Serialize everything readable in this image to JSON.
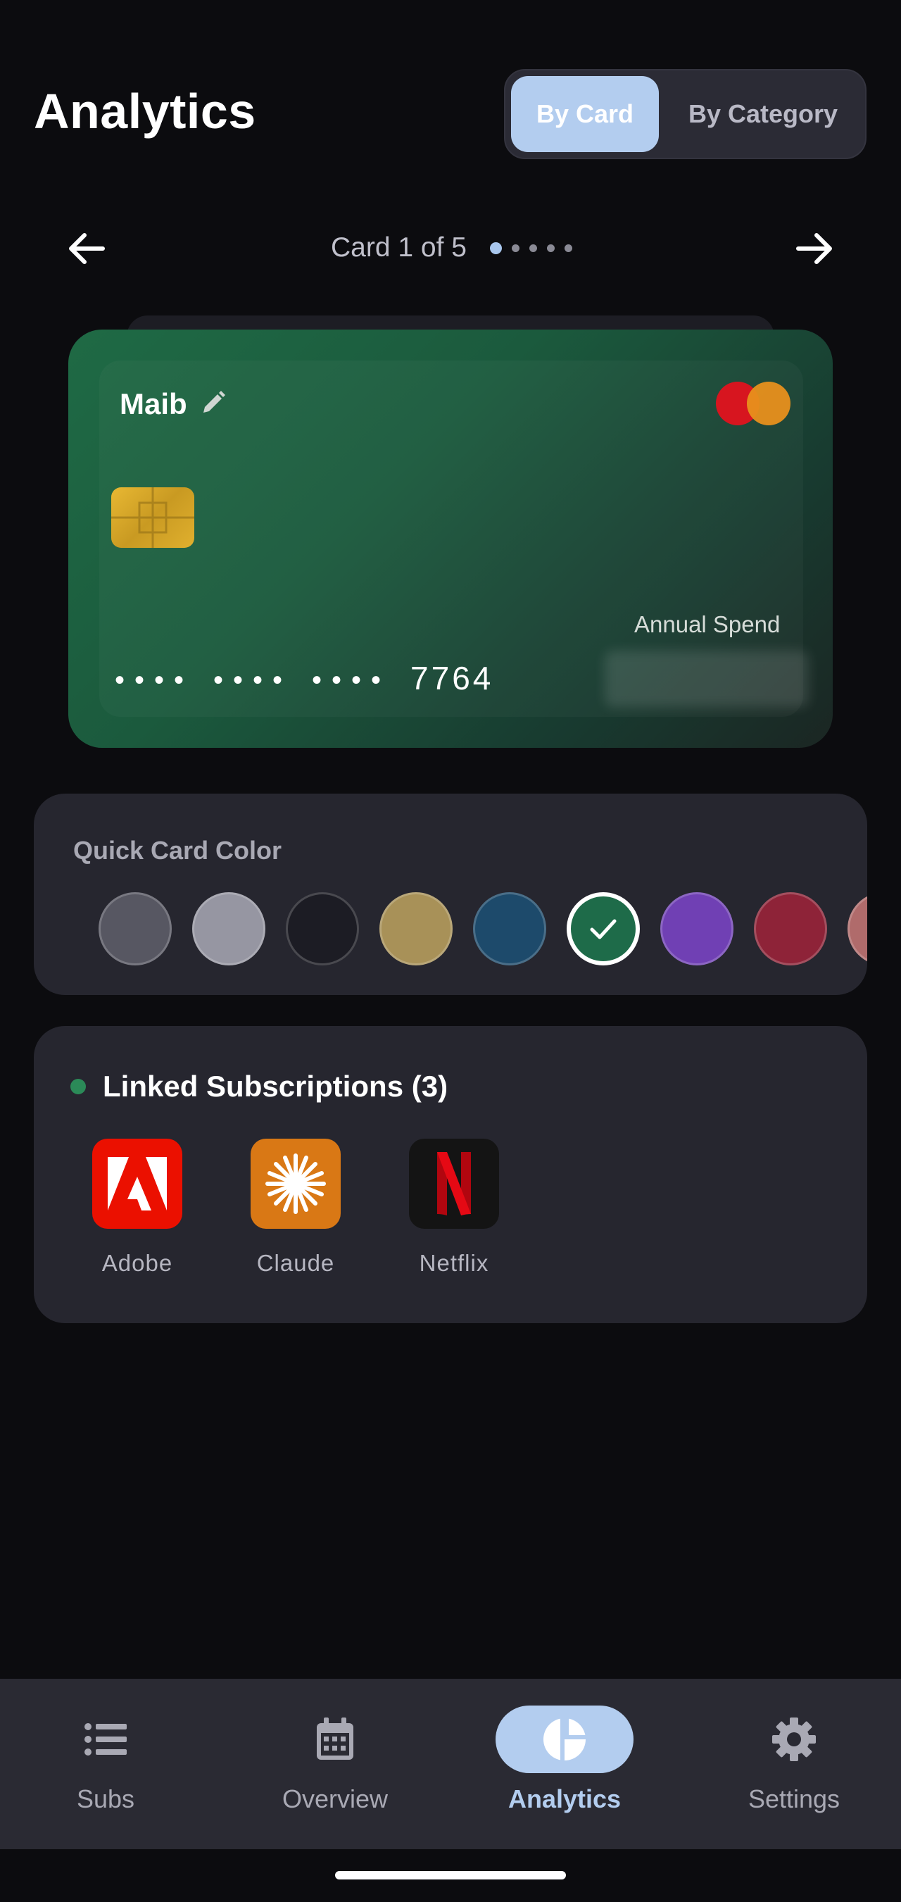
{
  "header": {
    "title": "Analytics",
    "segments": [
      "By Card",
      "By Category"
    ],
    "active_segment": "By Card"
  },
  "pager": {
    "text": "Card 1 of 5",
    "current": 1,
    "total": 5
  },
  "card": {
    "name": "Maib",
    "network_icon": "mastercard-logo",
    "number_mask": [
      "••••",
      "••••",
      "••••"
    ],
    "last4": "7764",
    "annual_spend_label": "Annual Spend",
    "gradient": [
      "#1f6a45",
      "#1b2623"
    ]
  },
  "quick_color": {
    "label": "Quick Card Color",
    "swatches": [
      "#575762",
      "#9696a2",
      "#1c1c24",
      "#a89158",
      "#1d4a6b",
      "#1e6b49",
      "#7040b4",
      "#8e2338",
      "#b06b6b"
    ],
    "selected_index": 5
  },
  "subscriptions": {
    "title": "Linked Subscriptions (3)",
    "status_color": "#2b8a58",
    "items": [
      {
        "name": "Adobe",
        "icon": "adobe-logo",
        "bg": "#eb1000"
      },
      {
        "name": "Claude",
        "icon": "claude-logo",
        "bg": "#d97815"
      },
      {
        "name": "Netflix",
        "icon": "netflix-logo",
        "bg": "#141414"
      }
    ]
  },
  "bottom_nav": {
    "items": [
      {
        "label": "Subs",
        "icon": "list-icon"
      },
      {
        "label": "Overview",
        "icon": "calendar-icon"
      },
      {
        "label": "Analytics",
        "icon": "pie-chart-icon"
      },
      {
        "label": "Settings",
        "icon": "gear-icon"
      }
    ],
    "active": "Analytics"
  }
}
